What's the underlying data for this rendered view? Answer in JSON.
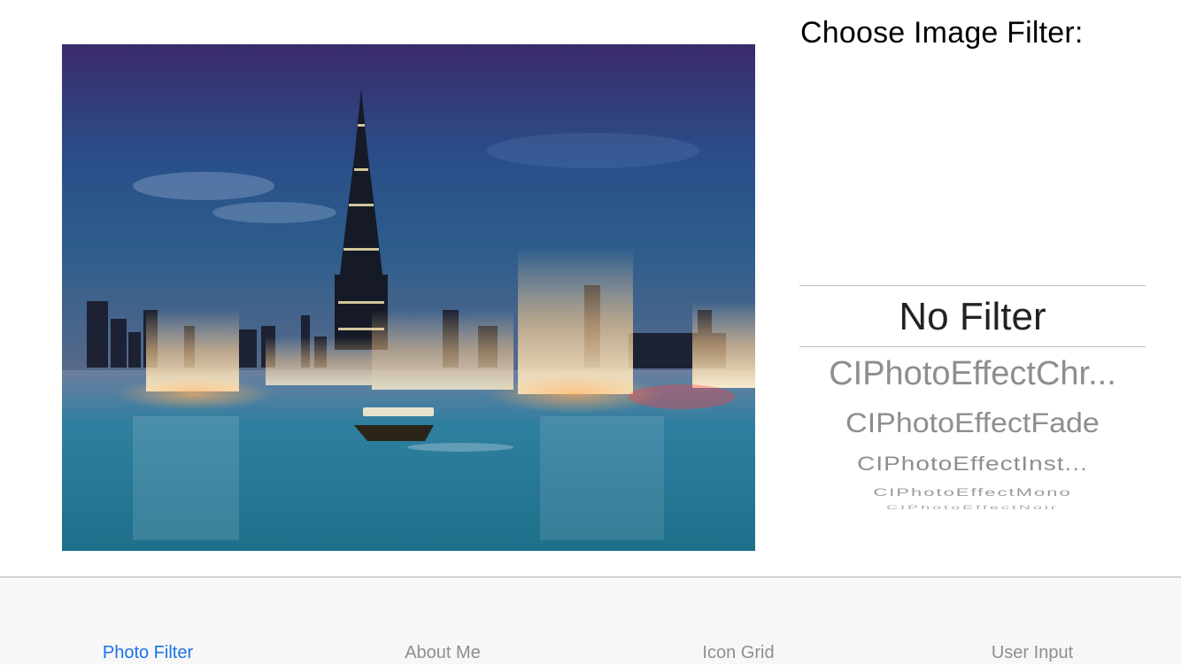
{
  "filter_panel": {
    "title": "Choose Image Filter:",
    "selected": "No Filter",
    "options": [
      "No Filter",
      "CIPhotoEffectChr...",
      "CIPhotoEffectFade",
      "CIPhotoEffectInst...",
      "CIPhotoEffectMono",
      "CIPhotoEffectNoir"
    ]
  },
  "photo": {
    "subject": "city-skyline-fountain-photo"
  },
  "tabbar": {
    "active_tab": 0,
    "tabs": [
      {
        "label": "Photo Filter"
      },
      {
        "label": "About Me"
      },
      {
        "label": "Icon Grid"
      },
      {
        "label": "User Input"
      }
    ]
  },
  "colors": {
    "accent": "#1a73e8",
    "inactive_tab": "#8e8e93",
    "tabbar_bg": "#f7f7f7"
  }
}
